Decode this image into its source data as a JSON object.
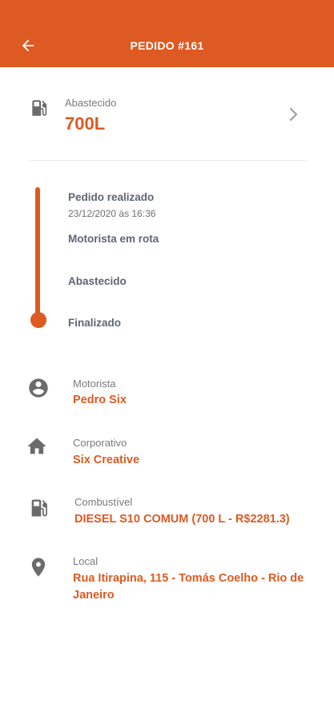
{
  "header": {
    "title": "PEDIDO #161",
    "back_icon": "arrow-left-icon",
    "background": "#dd5a22"
  },
  "summary": {
    "icon": "fuel-pump-icon",
    "label": "Abastecido",
    "value": "700L",
    "chevron_icon": "chevron-right-icon"
  },
  "timeline": {
    "steps": [
      {
        "label": "Pedido realizado",
        "timestamp": "23/12/2020 às 16:36"
      },
      {
        "label": "Motorista em rota"
      },
      {
        "label": "Abastecido"
      },
      {
        "label": "Finalizado"
      }
    ],
    "accent": "#dd5a22"
  },
  "details": {
    "driver": {
      "icon": "account-circle-icon",
      "label": "Motorista",
      "value": "Pedro Six"
    },
    "corporate": {
      "icon": "home-icon",
      "label": "Corporativo",
      "value": "Six Creative"
    },
    "fuel": {
      "icon": "fuel-pump-icon",
      "label": "Combustível",
      "value": "DIESEL S10 COMUM (700 L - R$2281.3)"
    },
    "location": {
      "icon": "map-pin-icon",
      "label": "Local",
      "value": "Rua Itirapina, 115 - Tomás Coelho - Rio de Janeiro"
    }
  }
}
